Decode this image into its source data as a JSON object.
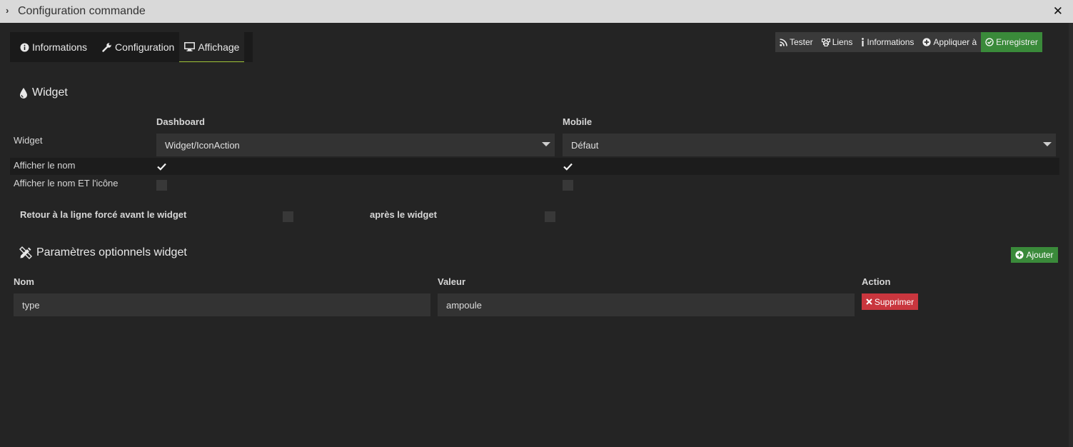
{
  "window": {
    "title": "Configuration commande",
    "close_glyph": "✕"
  },
  "tabs": [
    {
      "label": "Informations",
      "icon": "info-circle-icon"
    },
    {
      "label": "Configuration",
      "icon": "wrench-icon"
    },
    {
      "label": "Affichage",
      "icon": "desktop-icon",
      "active": true
    }
  ],
  "actions": {
    "tester": "Tester",
    "liens": "Liens",
    "informations": "Informations",
    "appliquer": "Appliquer à",
    "enregistrer": "Enregistrer"
  },
  "widget_section": {
    "title": "Widget",
    "col_dashboard": "Dashboard",
    "col_mobile": "Mobile",
    "row_widget": "Widget",
    "dashboard_value": "Widget/IconAction",
    "mobile_value": "Défaut",
    "row_show_name": "Afficher le nom",
    "row_show_name_icon": "Afficher le nom ET l'icône",
    "show_name_dashboard": true,
    "show_name_mobile": true,
    "show_name_icon_dashboard": false,
    "show_name_icon_mobile": false,
    "linebreak_before": "Retour à la ligne forcé avant le widget",
    "linebreak_after": "après le widget"
  },
  "params_section": {
    "title": "Paramètres optionnels widget",
    "add_label": "Ajouter",
    "col_nom": "Nom",
    "col_valeur": "Valeur",
    "col_action": "Action",
    "rows": [
      {
        "nom": "type",
        "valeur": "ampoule",
        "delete_label": "Supprimer"
      }
    ]
  },
  "colors": {
    "accent": "#9fc537",
    "success": "#3a8a3a",
    "danger": "#c9363e",
    "background": "#242424"
  }
}
